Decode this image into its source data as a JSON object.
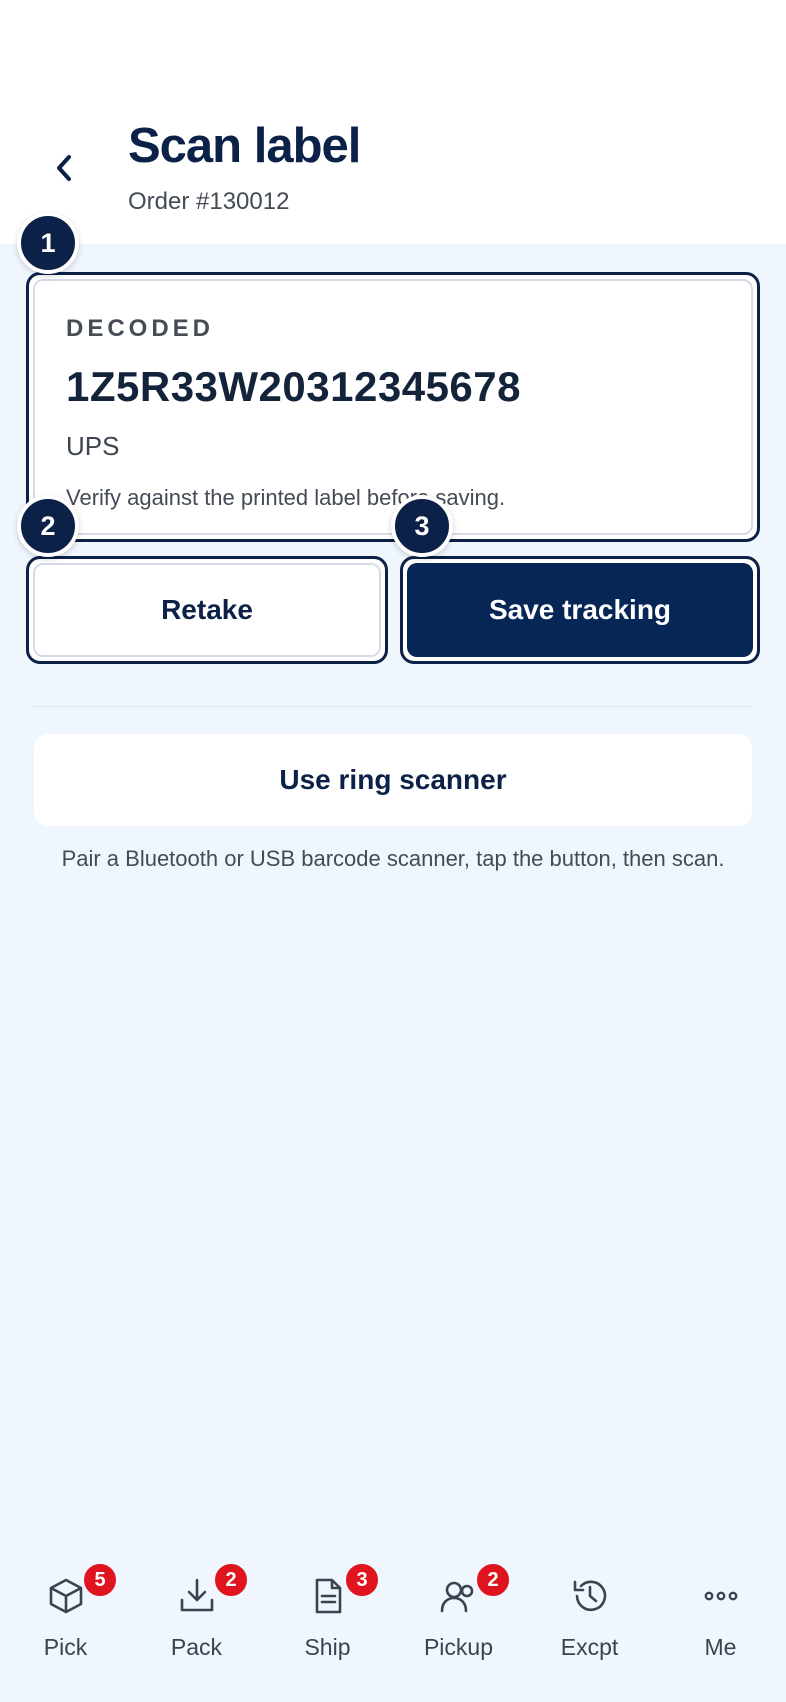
{
  "header": {
    "title": "Scan label",
    "subtitle": "Order #130012"
  },
  "steps": [
    "1",
    "2",
    "3"
  ],
  "decoded": {
    "label": "DECODED",
    "value": "1Z5R33W20312345678",
    "carrier": "UPS",
    "note": "Verify against the printed label before saving."
  },
  "actions": {
    "retake_label": "Retake",
    "save_label": "Save tracking"
  },
  "ring_scanner": {
    "button_label": "Use ring scanner",
    "hint": "Pair a Bluetooth or USB barcode scanner, tap the button, then scan."
  },
  "nav": {
    "items": [
      {
        "label": "Pick",
        "icon": "box-icon",
        "badge": "5"
      },
      {
        "label": "Pack",
        "icon": "download-icon",
        "badge": "2"
      },
      {
        "label": "Ship",
        "icon": "document-icon",
        "badge": "3"
      },
      {
        "label": "Pickup",
        "icon": "users-icon",
        "badge": "2"
      },
      {
        "label": "Excpt",
        "icon": "history-icon",
        "badge": ""
      },
      {
        "label": "Me",
        "icon": "more-icon",
        "badge": ""
      }
    ]
  },
  "colors": {
    "primary": "#0b2148",
    "save_button": "#062656",
    "badge": "#e0141e",
    "background": "#f0f6fd"
  }
}
